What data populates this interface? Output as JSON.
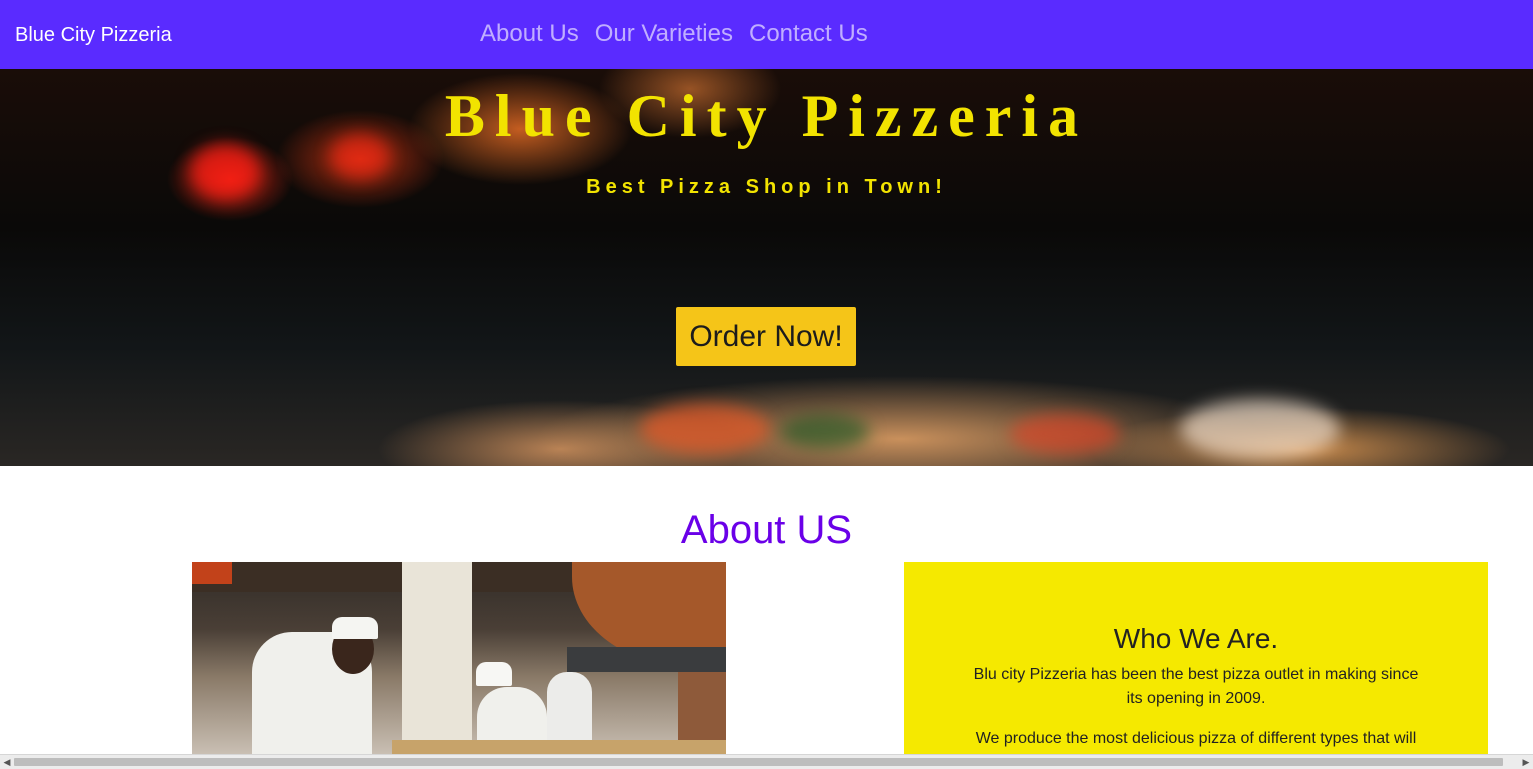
{
  "navbar": {
    "brand": "Blue City Pizzeria",
    "links": [
      "About Us",
      "Our Varieties",
      "Contact Us"
    ],
    "background": "#5a2bff"
  },
  "hero": {
    "title": "Blue City Pizzeria",
    "subtitle": "Best Pizza Shop in Town!",
    "cta_label": "Order Now!",
    "accent": "#f2e300",
    "cta_color": "#f5c518"
  },
  "about": {
    "heading": "About US",
    "heading_color": "#6a00e8",
    "who": {
      "title": "Who We Are.",
      "paragraph_1": "Blu city Pizzeria has been the best pizza outlet in making since its opening in 2009.",
      "paragraph_2": "We produce the most delicious pizza of different types that will",
      "background": "#f5e900"
    }
  },
  "icons": {
    "scroll_left": "arrow-left-icon",
    "scroll_right": "arrow-right-icon"
  }
}
